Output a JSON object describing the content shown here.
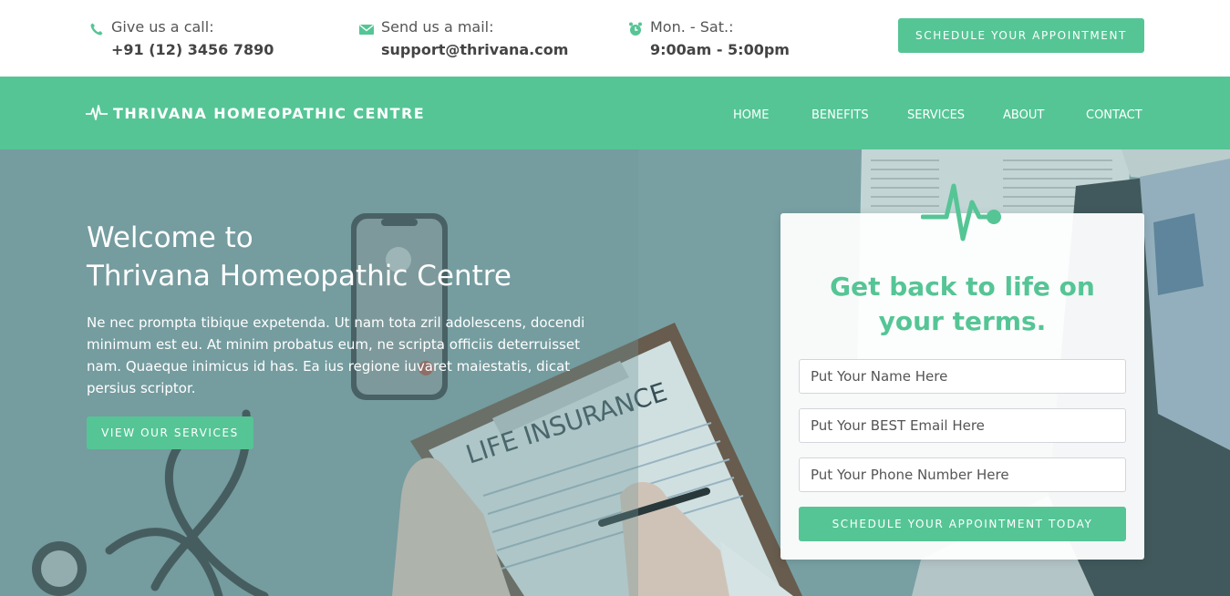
{
  "colors": {
    "accent": "#55c595",
    "hero_overlay": "#7b9ea2",
    "white": "#ffffff"
  },
  "topbar": {
    "call": {
      "label": "Give us a call:",
      "value": "+91 (12) 3456 7890",
      "icon": "phone-icon"
    },
    "mail": {
      "label": "Send us a mail:",
      "value": "support@thrivana.com",
      "icon": "envelope-icon"
    },
    "hours": {
      "label": "Mon. - Sat.:",
      "value": "9:00am - 5:00pm",
      "icon": "alarm-clock-icon"
    },
    "cta": "SCHEDULE YOUR APPOINTMENT"
  },
  "navbar": {
    "brand": "THRIVANA HOMEOPATHIC CENTRE",
    "brand_icon": "heartbeat-icon",
    "items": [
      {
        "label": "HOME"
      },
      {
        "label": "BENEFITS"
      },
      {
        "label": "SERVICES"
      },
      {
        "label": "ABOUT"
      },
      {
        "label": "CONTACT"
      }
    ]
  },
  "hero": {
    "title_line1": "Welcome to",
    "title_line2": "Thrivana Homeopathic Centre",
    "text": "Ne nec prompta tibique expetenda. Ut nam tota zril adolescens, docendi minimum est eu. At minim probatus eum, ne scripta officiis deterruisset nam. Quaeque inimicus id has. Ea ius regione iuvaret maiestatis, dicat persius scriptor.",
    "button": "VIEW OUR SERVICES",
    "image_text": {
      "clipboard": "LIFE INSURANCE"
    }
  },
  "form": {
    "logo_icon": "heartbeat-icon",
    "title": "Get back to life on your terms.",
    "name_placeholder": "Put Your Name Here",
    "email_placeholder": "Put Your BEST Email Here",
    "phone_placeholder": "Put Your Phone Number Here",
    "submit": "SCHEDULE YOUR APPOINTMENT TODAY"
  }
}
